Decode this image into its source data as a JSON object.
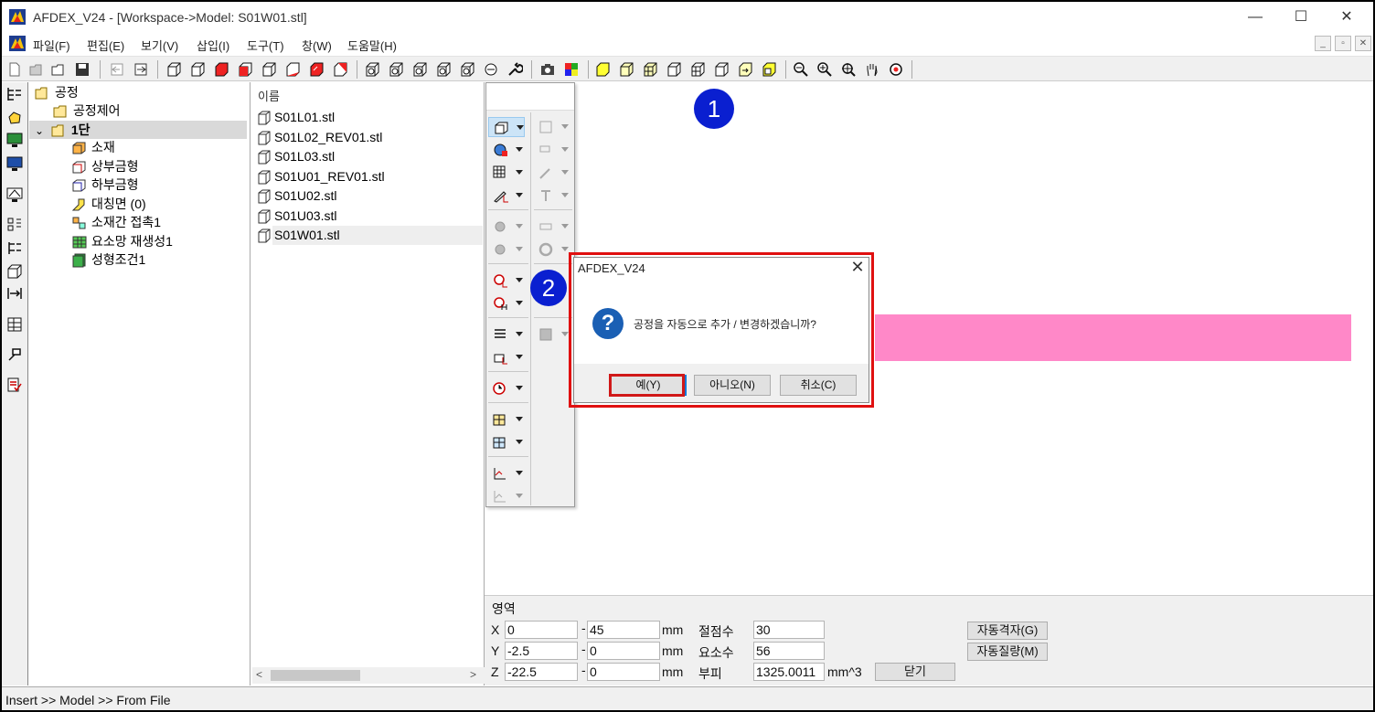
{
  "window": {
    "title": "AFDEX_V24 - [Workspace->Model: S01W01.stl]",
    "minimize": "—",
    "maximize": "☐",
    "close": "✕"
  },
  "menu": {
    "items": [
      "파일(F)",
      "편집(E)",
      "보기(V)",
      "삽입(I)",
      "도구(T)",
      "창(W)",
      "도움말(H)"
    ],
    "mdi_controls": [
      "_",
      "▫",
      "✕"
    ]
  },
  "tree": {
    "root": "공정",
    "items": [
      {
        "label": "공정제어"
      },
      {
        "label": "1단"
      },
      {
        "label": "소재"
      },
      {
        "label": "상부금형"
      },
      {
        "label": "하부금형"
      },
      {
        "label": "대칭면 (0)"
      },
      {
        "label": "소재간 접촉1"
      },
      {
        "label": "요소망 재생성1"
      },
      {
        "label": "성형조건1"
      }
    ]
  },
  "filelist": {
    "header": "이름",
    "files": [
      "S01L01.stl",
      "S01L02_REV01.stl",
      "S01L03.stl",
      "S01U01_REV01.stl",
      "S01U02.stl",
      "S01U03.stl",
      "S01W01.stl"
    ],
    "selected": "S01W01.stl"
  },
  "badges": {
    "one": "1",
    "two": "2"
  },
  "dialog": {
    "title": "AFDEX_V24",
    "close": "✕",
    "icon": "?",
    "message": "공정을 자동으로 추가 / 변경하겠습니까?",
    "buttons": {
      "yes": "예(Y)",
      "no": "아니오(N)",
      "cancel": "취소(C)"
    }
  },
  "props": {
    "section_label": "영역",
    "x_label": "X",
    "x_min": "0",
    "x_max": "45",
    "y_label": "Y",
    "y_min": "-2.5",
    "y_max": "0",
    "z_label": "Z",
    "z_min": "-22.5",
    "z_max": "0",
    "dash": "-",
    "unit_mm": "mm",
    "nodes_label": "절점수",
    "nodes_value": "30",
    "elements_label": "요소수",
    "elements_value": "56",
    "volume_label": "부피",
    "volume_value": "1325.0011",
    "volume_unit": "mm^3",
    "auto_grid_button": "자동격자(G)",
    "auto_mass_button": "자동질량(M)",
    "close_button": "닫기"
  },
  "status": {
    "text": "Insert >> Model >> From File"
  },
  "colors": {
    "highlight_red": "#e01010",
    "badge_blue": "#0a1fd0",
    "pink_region": "#ff88c8",
    "dialog_icon_blue": "#1a5fb4"
  }
}
